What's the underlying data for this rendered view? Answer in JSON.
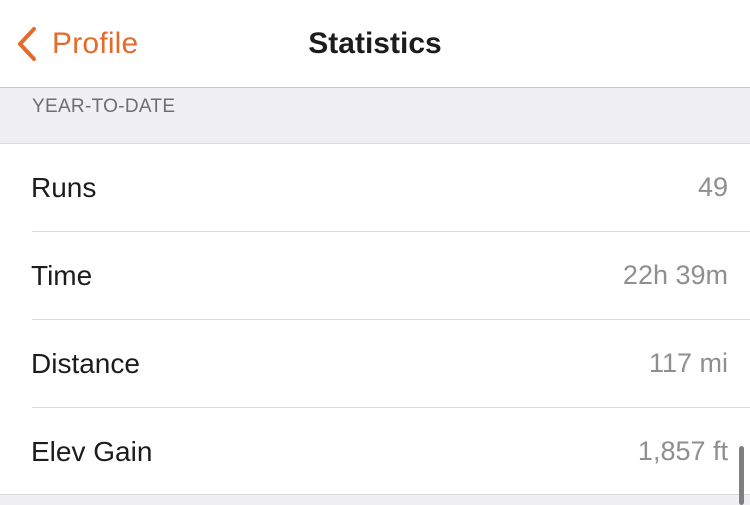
{
  "nav": {
    "back_label": "Profile",
    "title": "Statistics",
    "accent_color": "#e56b2c"
  },
  "section": {
    "title": "YEAR-TO-DATE"
  },
  "rows": [
    {
      "label": "Runs",
      "value": "49"
    },
    {
      "label": "Time",
      "value": "22h 39m"
    },
    {
      "label": "Distance",
      "value": "117 mi"
    },
    {
      "label": "Elev Gain",
      "value": "1,857 ft"
    }
  ],
  "icons": {
    "back": "chevron-left-icon"
  }
}
